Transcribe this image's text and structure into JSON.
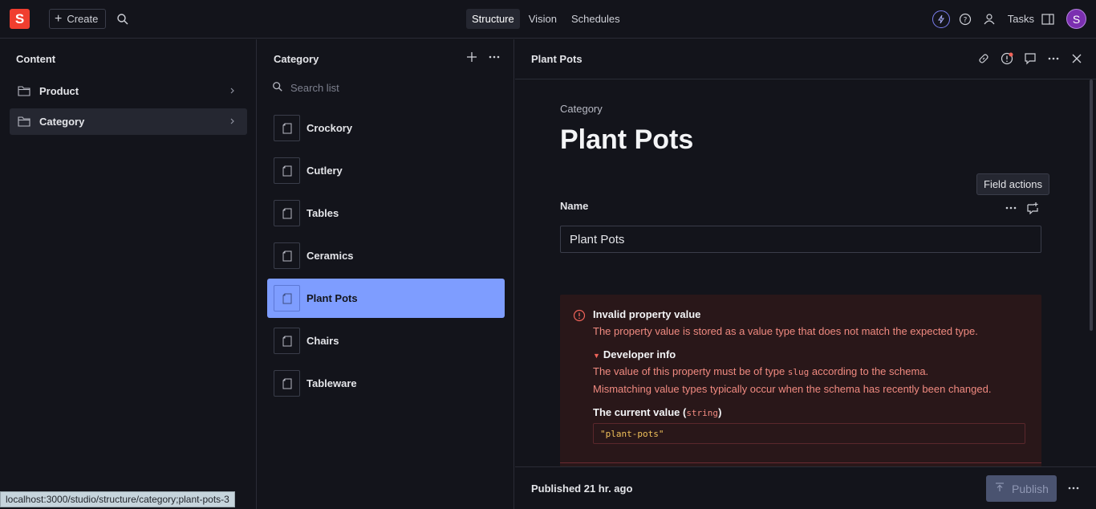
{
  "nav": {
    "logo": "S",
    "create_label": "Create",
    "tabs": [
      {
        "label": "Structure",
        "active": true
      },
      {
        "label": "Vision",
        "active": false
      },
      {
        "label": "Schedules",
        "active": false
      }
    ],
    "tasks_label": "Tasks",
    "avatar_initial": "S"
  },
  "content_pane": {
    "title": "Content",
    "items": [
      {
        "label": "Product",
        "selected": false
      },
      {
        "label": "Category",
        "selected": true
      }
    ]
  },
  "list_pane": {
    "title": "Category",
    "search_placeholder": "Search list",
    "items": [
      {
        "label": "Crockory"
      },
      {
        "label": "Cutlery"
      },
      {
        "label": "Tables"
      },
      {
        "label": "Ceramics"
      },
      {
        "label": "Plant Pots",
        "selected": true
      },
      {
        "label": "Chairs"
      },
      {
        "label": "Tableware"
      }
    ]
  },
  "doc_pane": {
    "header_title": "Plant Pots",
    "type_label": "Category",
    "title": "Plant Pots",
    "tooltip": "Field actions",
    "field_label": "Name",
    "field_value": "Plant Pots",
    "error": {
      "title": "Invalid property value",
      "description": "The property value is stored as a value type that does not match the expected type.",
      "dev_info_label": "Developer info",
      "line1_pre": "The value of this property must be of type ",
      "line1_code": "slug",
      "line1_post": " according to the schema.",
      "line2": "Mismatching value types typically occur when the schema has recently been changed.",
      "current_value_pre": "The current value (",
      "current_value_code": "string",
      "current_value_post": ")",
      "current_value": "\"plant-pots\""
    },
    "footer_status": "Published 21 hr. ago",
    "publish_label": "Publish"
  },
  "statusbar_url": "localhost:3000/studio/structure/category;plant-pots-3",
  "colors": {
    "background": "#13141b",
    "accent_selected": "#7e9dff",
    "logo_red": "#f03e2f",
    "error_bg": "#291719",
    "error_text": "#f08a80"
  }
}
